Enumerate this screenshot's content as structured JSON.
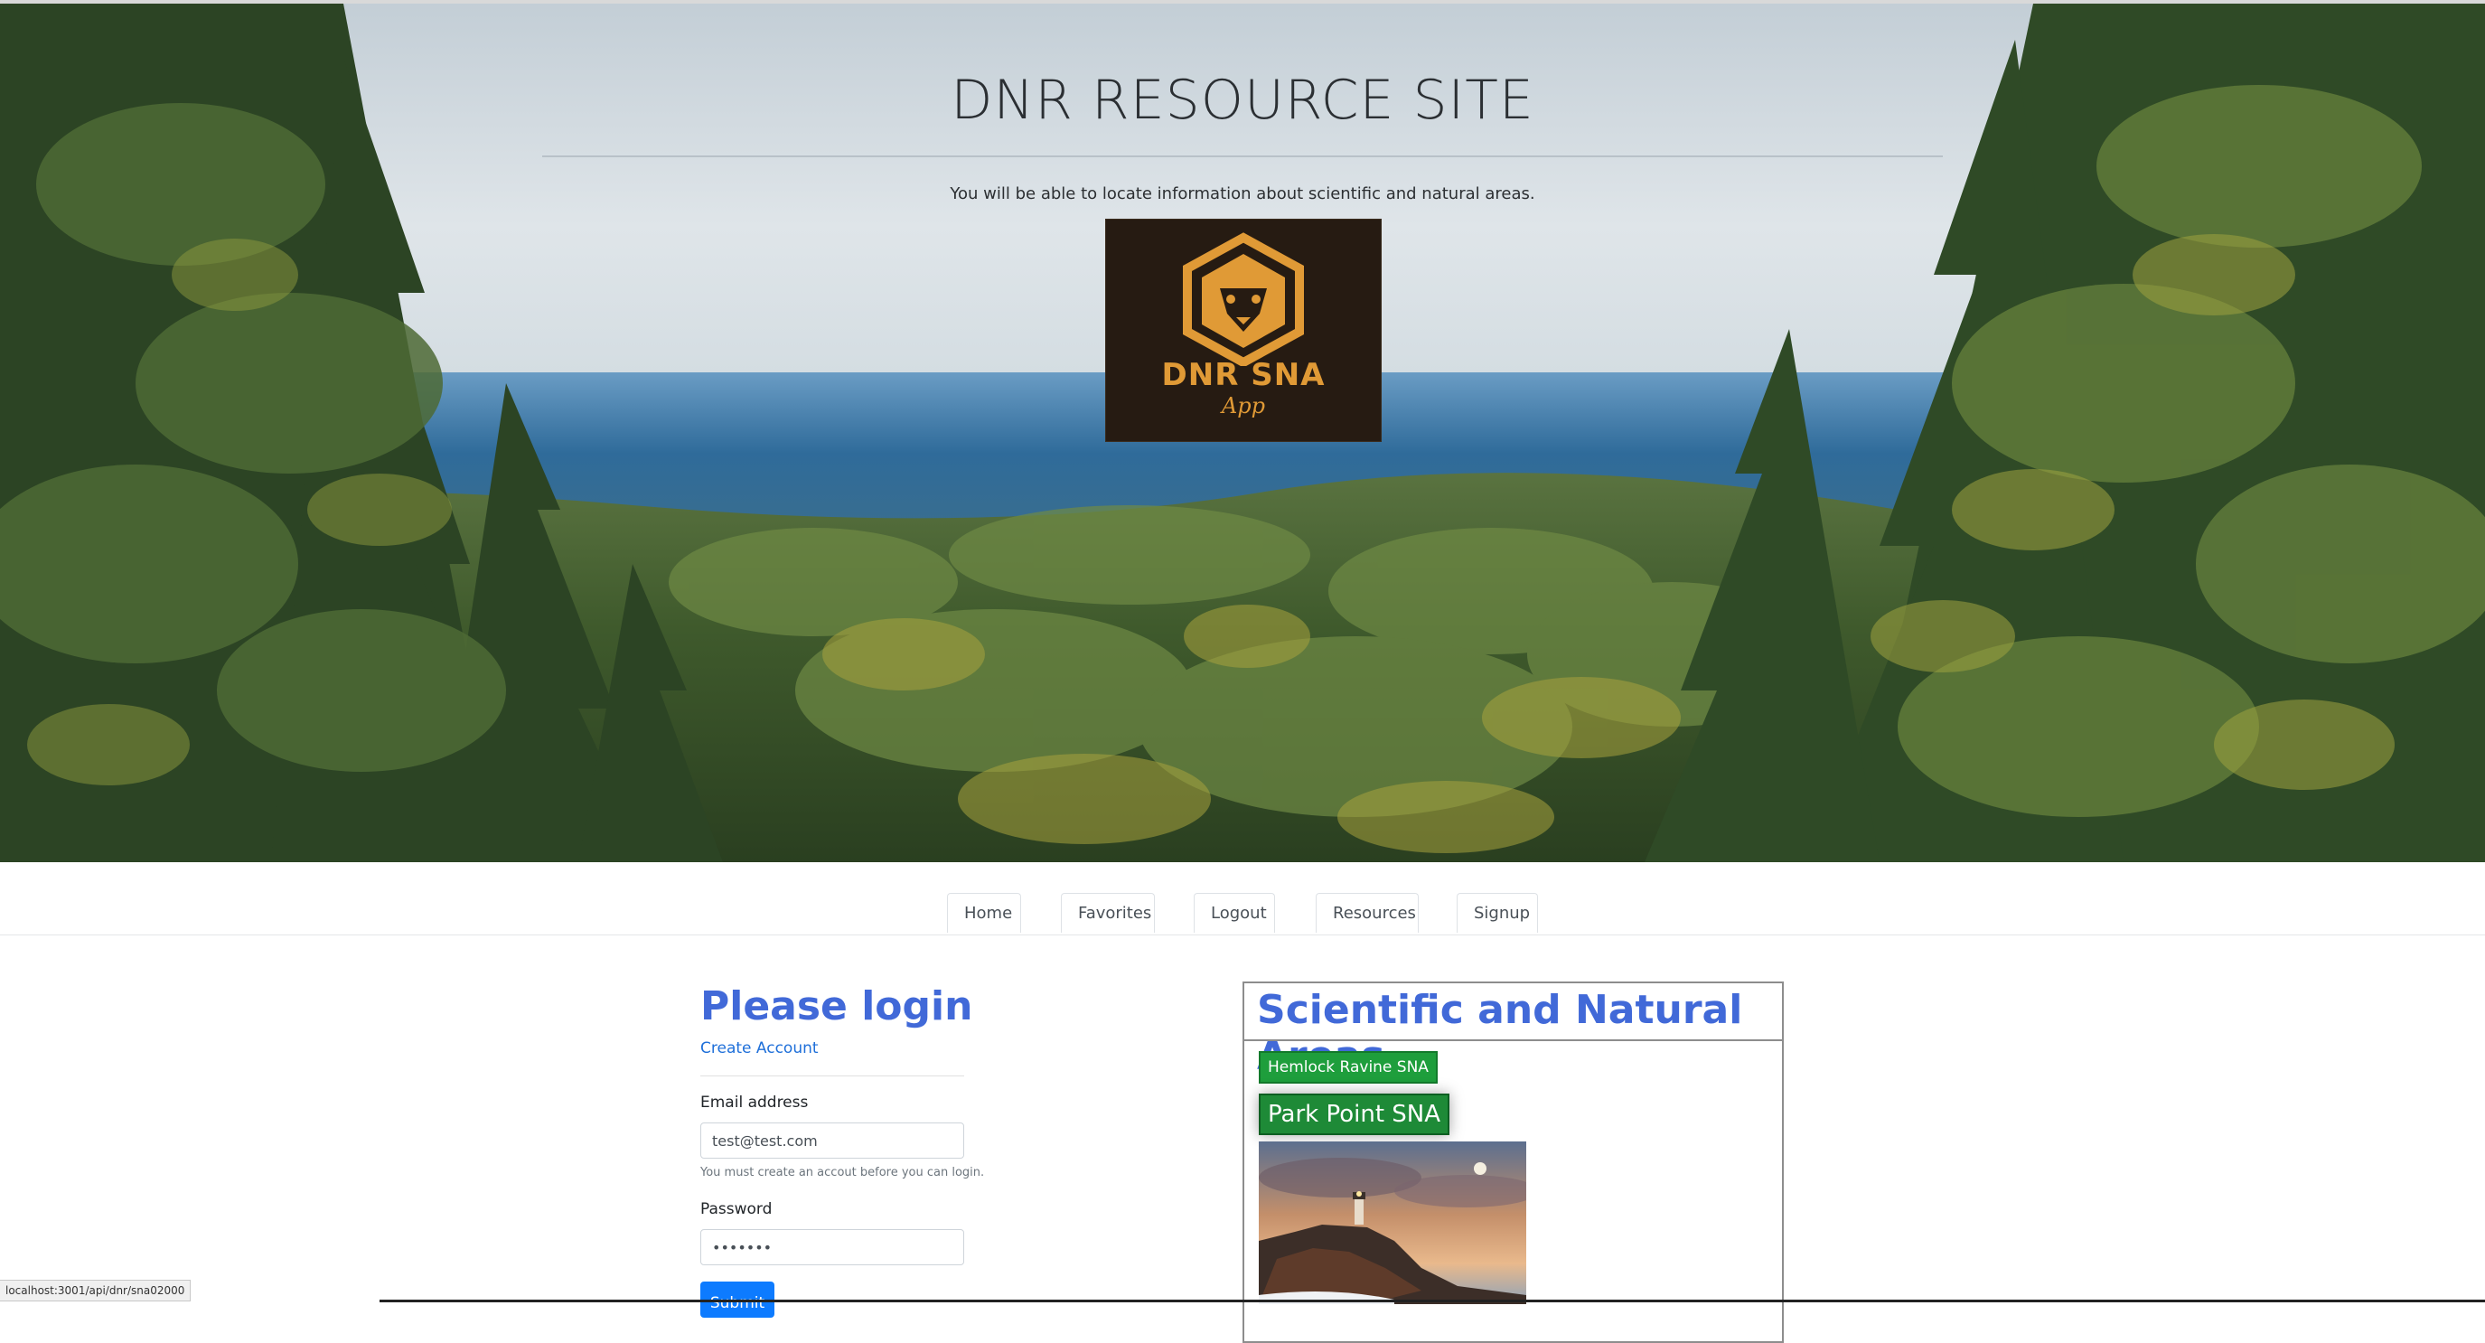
{
  "hero": {
    "title": "DNR RESOURCE SITE",
    "tagline": "You will be able to locate information about scientific and natural areas.",
    "logo_text": "DNR SNA",
    "logo_sub": "App",
    "logo_icon": "lion-hexagon-icon"
  },
  "nav": {
    "tabs": [
      {
        "label": "Home"
      },
      {
        "label": "Favorites"
      },
      {
        "label": "Logout"
      },
      {
        "label": "Resources"
      },
      {
        "label": "Signup"
      }
    ]
  },
  "login": {
    "title": "Please login",
    "create_account": "Create Account",
    "email_label": "Email address",
    "email_value": "test@test.com",
    "email_help": "You must create an accout before you can login.",
    "password_label": "Password",
    "password_value": "•••••••",
    "submit_label": "Submit"
  },
  "sna": {
    "title": "Scientific and Natural Areas",
    "items": [
      {
        "label": "Hemlock Ravine SNA"
      },
      {
        "label": "Park Point SNA"
      }
    ]
  },
  "status_bar": {
    "url": "localhost:3001/api/dnr/sna02000"
  },
  "colors": {
    "heading_blue": "#4169d8",
    "link_blue": "#1e6fd9",
    "sna_green": "#1e9e3c",
    "logo_gold": "#e09a36",
    "logo_bg": "#261b12"
  }
}
